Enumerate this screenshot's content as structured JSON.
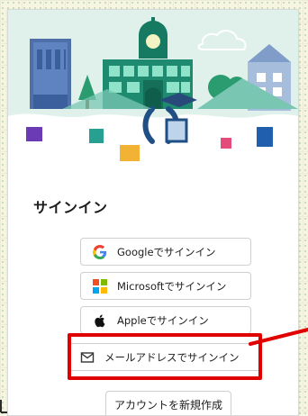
{
  "signin": {
    "title": "サインイン",
    "buttons": {
      "google": "Googleでサインイン",
      "microsoft": "Microsoftでサインイン",
      "apple": "Appleでサインイン",
      "email": "メールアドレスでサインイン"
    },
    "create_account": "アカウントを新規作成"
  },
  "icons": {
    "google": "google-icon",
    "microsoft": "microsoft-icon",
    "apple": "apple-icon",
    "email": "mail-icon"
  },
  "colors": {
    "highlight": "#e00000",
    "hero_sky": "#d7efe8",
    "hero_teal": "#79c7b3"
  }
}
